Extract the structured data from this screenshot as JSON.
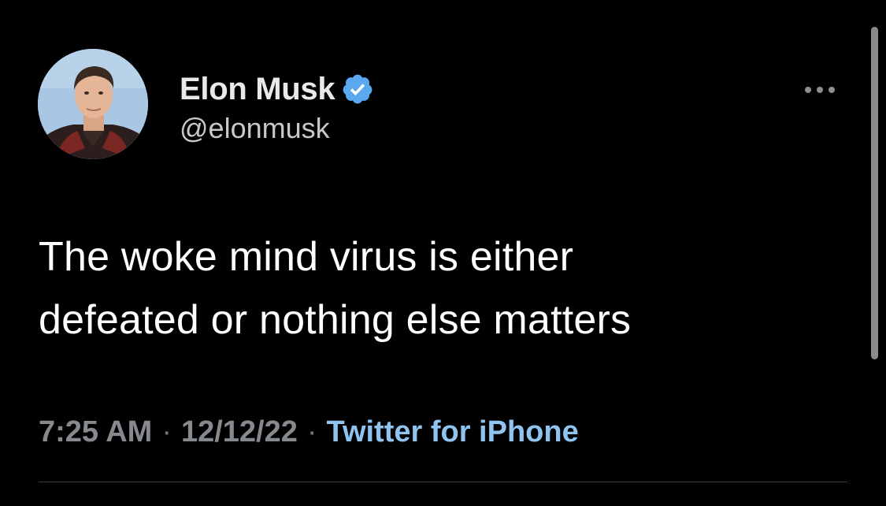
{
  "author": {
    "display_name": "Elon Musk",
    "handle": "@elonmusk",
    "verified_icon": "verified-badge-icon",
    "avatar_icon": "profile-photo"
  },
  "tweet": {
    "text": "The woke mind virus is either\ndefeated or nothing else matters"
  },
  "meta": {
    "time": "7:25 AM",
    "separator": "·",
    "date": "12/12/22",
    "source": "Twitter for iPhone"
  },
  "more_icon": "more-options-icon",
  "colors": {
    "background": "#000000",
    "text": "#ffffff",
    "muted": "#71767b",
    "link": "#8fc3f0",
    "verified": "#5aa8f0"
  }
}
